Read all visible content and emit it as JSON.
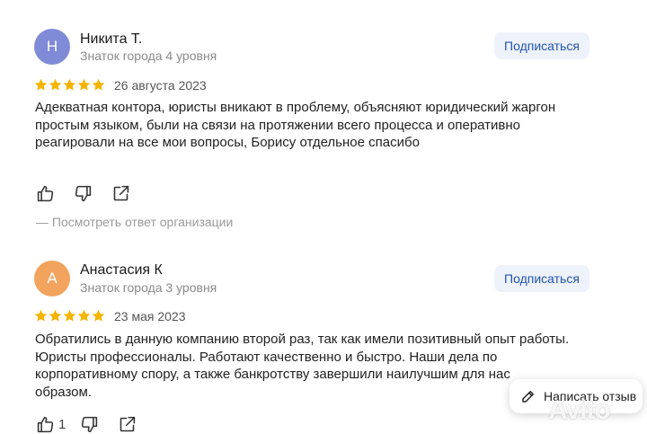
{
  "colors": {
    "star": "#f5b400",
    "avatar1": "#7f8bd6",
    "avatar2": "#f2a35e",
    "link": "#2255aa"
  },
  "reviews": [
    {
      "initial": "Н",
      "name": "Никита Т.",
      "level": "Знаток города 4 уровня",
      "subscribe_label": "Подписаться",
      "rating": 5,
      "date": "26 августа 2023",
      "text_lines": [
        "Адекватная контора, юристы вникают в проблему, объясняют юридический жаргон",
        "простым языком, были на связи на протяжении всего процесса и оперативно",
        "реагировали на все мои вопросы, Борису отдельное спасибо"
      ],
      "org_reply": "— Посмотреть ответ организации"
    },
    {
      "initial": "А",
      "name": "Анастасия К",
      "level": "Знаток города 3 уровня",
      "subscribe_label": "Подписаться",
      "rating": 5,
      "date": "23 мая 2023",
      "text_lines": [
        "Обратились в данную компанию второй раз, так как имели позитивный опыт работы.",
        "Юристы профессионалы. Работают качественно и быстро. Наши дела по",
        "корпоративному спору, а также банкротству завершили наилучшим для нас",
        "образом."
      ],
      "like_count": "1"
    }
  ],
  "write_review_label": "Написать отзыв",
  "watermark": "Avito",
  "icons": [
    "thumbs-up-icon",
    "thumbs-down-icon",
    "share-icon",
    "pencil-icon",
    "star-icon"
  ]
}
